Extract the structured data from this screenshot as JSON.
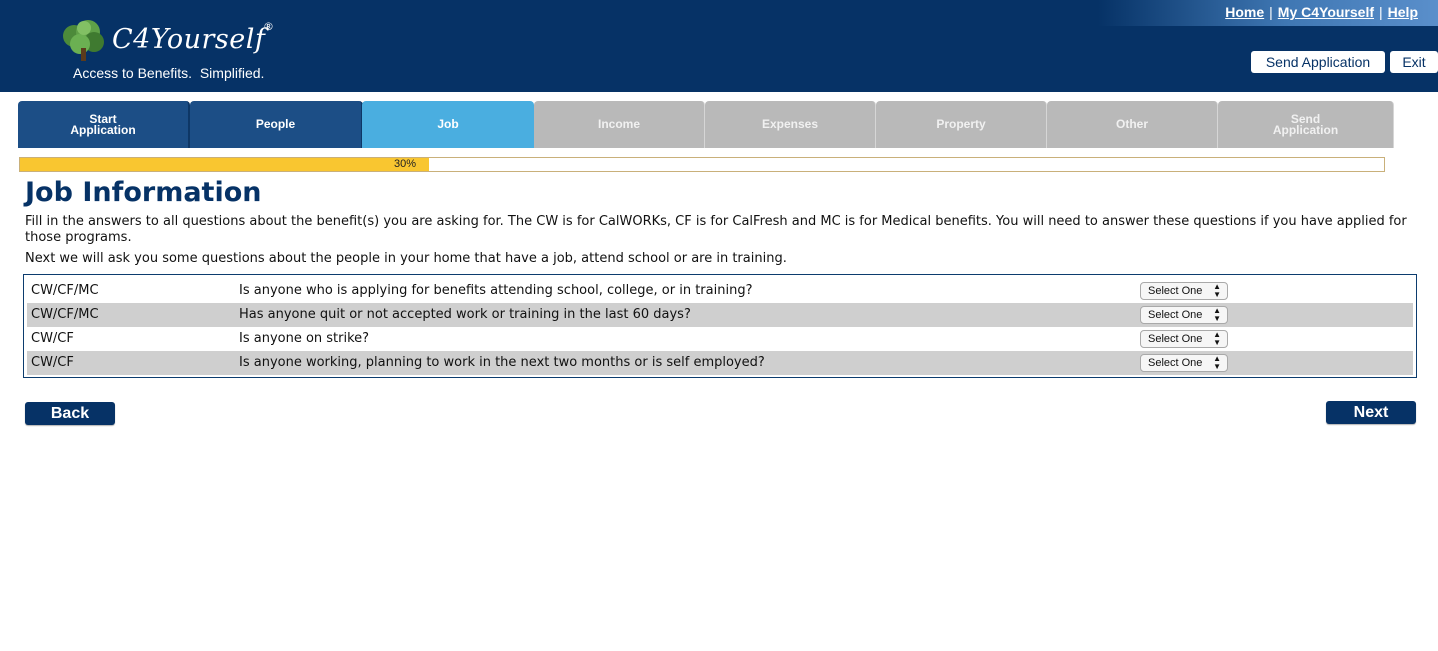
{
  "header": {
    "logo_text": "C4Yourself",
    "logo_mark": "®",
    "tagline": "Access to Benefits.  Simplified.",
    "links": [
      "Home",
      "My C4Yourself",
      "Help"
    ],
    "send_application": "Send Application",
    "exit": "Exit"
  },
  "steps": [
    {
      "label": "Start\nApplication",
      "state": "done"
    },
    {
      "label": "People",
      "state": "done"
    },
    {
      "label": "Job",
      "state": "active"
    },
    {
      "label": "Income",
      "state": "todo"
    },
    {
      "label": "Expenses",
      "state": "todo"
    },
    {
      "label": "Property",
      "state": "todo"
    },
    {
      "label": "Other",
      "state": "todo"
    },
    {
      "label": "Send\nApplication",
      "state": "todo"
    }
  ],
  "progress": {
    "percent": 30,
    "label": "30%"
  },
  "page": {
    "title": "Job Information",
    "intro": "Fill in the answers to all questions about the benefit(s) you are asking for. The CW is for CalWORKs, CF is for CalFresh and MC is for Medical benefits. You will need to answer these questions if you have applied for those programs.",
    "intro2": "Next we will ask you some questions about the people in your home that have a job, attend school or are in training."
  },
  "questions": [
    {
      "programs": "CW/CF/MC",
      "text": "Is anyone who is applying for benefits attending school, college, or in training?",
      "answer": "Select One"
    },
    {
      "programs": "CW/CF/MC",
      "text": "Has anyone quit or not accepted work or training in the last 60 days?",
      "answer": "Select One"
    },
    {
      "programs": "CW/CF",
      "text": "Is anyone on strike?",
      "answer": "Select One"
    },
    {
      "programs": "CW/CF",
      "text": "Is anyone working, planning to work in the next two months or is self employed?",
      "answer": "Select One"
    }
  ],
  "nav": {
    "back": "Back",
    "next": "Next"
  },
  "colors": {
    "brand": "#063266",
    "active_step": "#4aaee0",
    "progress": "#f9c630"
  }
}
